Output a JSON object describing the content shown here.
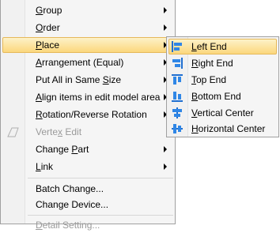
{
  "context_menu": {
    "items": [
      {
        "pre": "",
        "key": "G",
        "post": "roup"
      },
      {
        "pre": "",
        "key": "O",
        "post": "rder"
      },
      {
        "pre": "",
        "key": "P",
        "post": "lace"
      },
      {
        "pre": "",
        "key": "A",
        "post": "rrangement (Equal)"
      },
      {
        "pre": "Put All in Same ",
        "key": "S",
        "post": "ize"
      },
      {
        "pre": "",
        "key": "A",
        "post": "lign items in edit model area"
      },
      {
        "pre": "",
        "key": "R",
        "post": "otation/Reverse Rotation"
      },
      {
        "pre": "Verte",
        "key": "x",
        "post": " Edit"
      },
      {
        "pre": "Change ",
        "key": "P",
        "post": "art"
      },
      {
        "pre": "",
        "key": "L",
        "post": "ink"
      },
      {
        "pre": "Batch Change...",
        "key": "",
        "post": ""
      },
      {
        "pre": "Change Device...",
        "key": "",
        "post": ""
      },
      {
        "pre": "",
        "key": "D",
        "post": "etail Setting..."
      }
    ]
  },
  "place_submenu": {
    "items": [
      {
        "key": "L",
        "post": "eft End",
        "icon": "align-left-icon"
      },
      {
        "key": "R",
        "post": "ight End",
        "icon": "align-right-icon"
      },
      {
        "key": "T",
        "post": "op End",
        "icon": "align-top-icon"
      },
      {
        "key": "B",
        "post": "ottom End",
        "icon": "align-bottom-icon"
      },
      {
        "key": "V",
        "post": "ertical Center",
        "icon": "align-vertical-center-icon"
      },
      {
        "key": "H",
        "post": "orizontal Center",
        "icon": "align-horizontal-center-icon"
      }
    ]
  },
  "colors": {
    "highlight_top": "#fdf2c8",
    "highlight_bottom": "#fbd77d",
    "icon_blue": "#1f6fd1",
    "disabled_text": "#9a9a9a"
  }
}
